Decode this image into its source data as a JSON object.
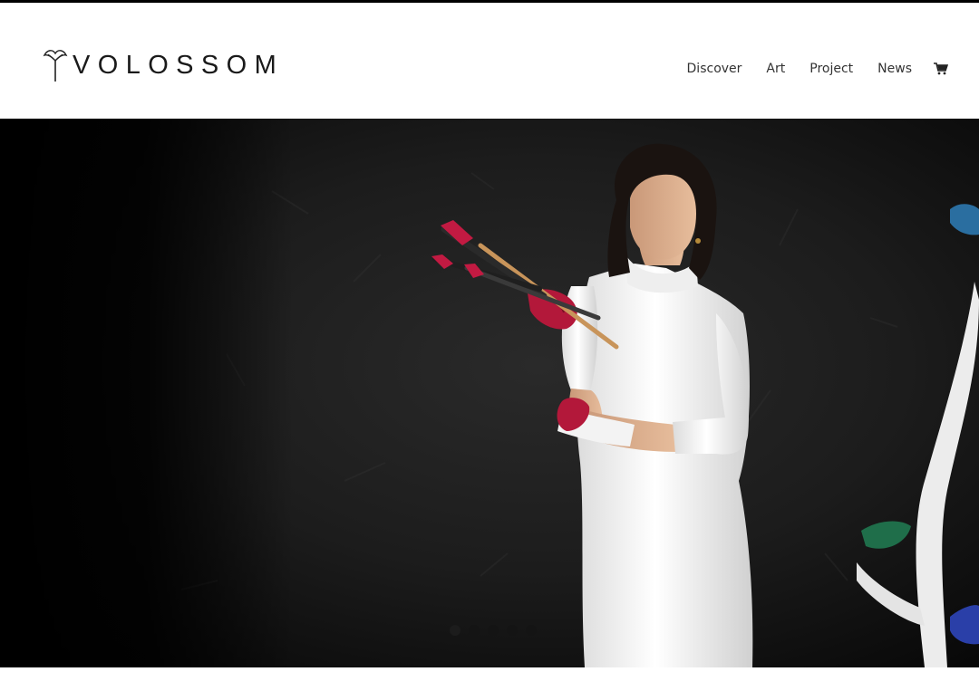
{
  "brand": {
    "name": "VOLOSSOM",
    "logo_icon": "ginkgo-flower-icon"
  },
  "nav": {
    "items": [
      {
        "label": "Discover"
      },
      {
        "label": "Art"
      },
      {
        "label": "Project"
      },
      {
        "label": "News"
      }
    ],
    "cart_icon": "shopping-cart-icon"
  },
  "hero": {
    "image": "artist-portrait-with-paintbrushes",
    "slider_dots": 5,
    "active_slide": 1
  },
  "colors": {
    "header_bg": "#ffffff",
    "text": "#333333",
    "hero_bg": "#0a0a0a",
    "paint_red": "#b3183a"
  }
}
